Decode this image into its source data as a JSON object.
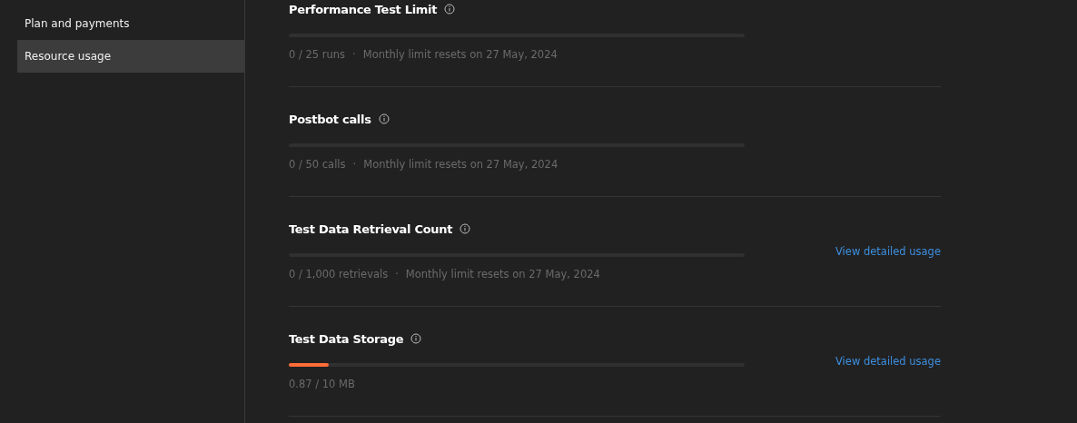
{
  "sidebar": {
    "items": [
      {
        "label": "Plan and payments",
        "selected": false
      },
      {
        "label": "Resource usage",
        "selected": true
      }
    ]
  },
  "limits": [
    {
      "title": "Performance Test Limit",
      "usage": "0 / 25 runs",
      "separator": "·",
      "reset": "Monthly limit resets on 27 May, 2024"
    },
    {
      "title": "Postbot calls",
      "usage": "0 / 50 calls",
      "separator": "·",
      "reset": "Monthly limit resets on 27 May, 2024"
    },
    {
      "title": "Test Data Retrieval Count",
      "usage": "0 / 1,000 retrievals",
      "separator": "·",
      "reset": "Monthly limit resets on 27 May, 2024",
      "link": "View detailed usage"
    },
    {
      "title": "Test Data Storage",
      "level": 0.087,
      "usage": "0.87 / 10 MB",
      "link": "View detailed usage"
    }
  ]
}
